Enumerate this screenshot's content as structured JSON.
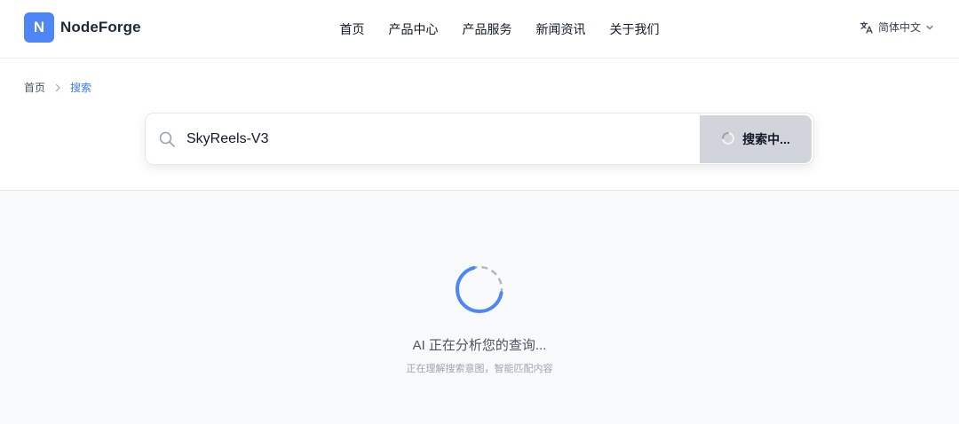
{
  "brand": {
    "logo_letter": "N",
    "name": "NodeForge",
    "accent": "#4f86f7"
  },
  "nav": {
    "items": [
      {
        "label": "首页"
      },
      {
        "label": "产品中心"
      },
      {
        "label": "产品服务"
      },
      {
        "label": "新闻资讯"
      },
      {
        "label": "关于我们"
      }
    ]
  },
  "language": {
    "label": "简体中文",
    "icon": "translate-icon",
    "dropdown_icon": "chevron-down-icon"
  },
  "breadcrumb": {
    "home": "首页",
    "current": "搜索",
    "current_color": "#3b7ae8"
  },
  "search": {
    "value": "SkyReels-V3",
    "button_label": "搜索中...",
    "icon": "search-icon"
  },
  "loading": {
    "title": "AI 正在分析您的查询...",
    "subtitle": "正在理解搜索意图，智能匹配内容"
  }
}
